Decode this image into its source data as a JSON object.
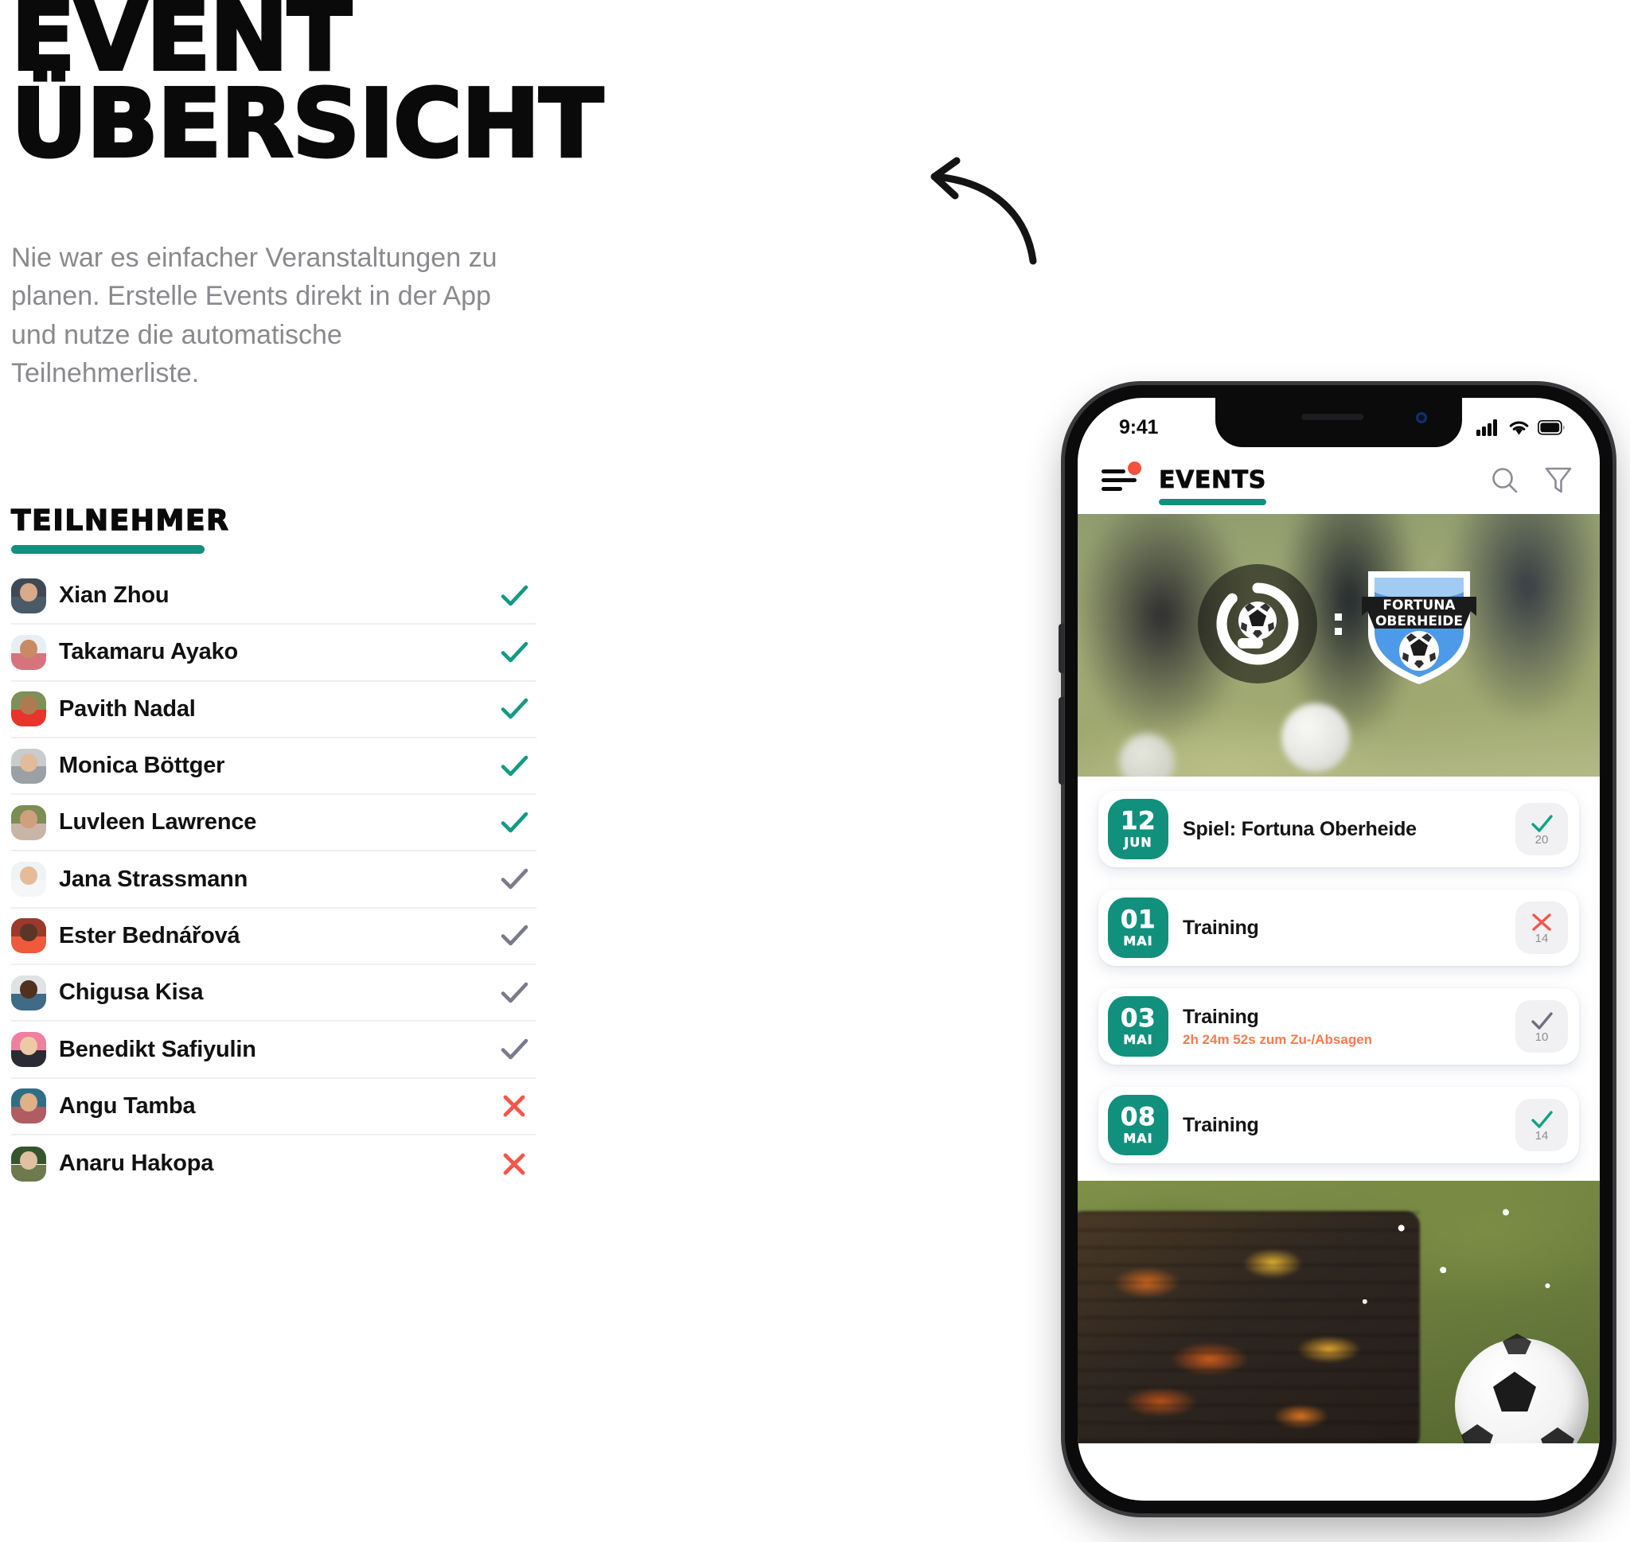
{
  "headline": {
    "line1": "EVENT",
    "line2": "ÜBERSICHT"
  },
  "lede": "Nie war es einfacher Veranstaltungen zu planen. Erstelle Events direkt in der App und nutze die automatische Teilnehmerliste.",
  "participants_section": {
    "heading": "TEILNEHMER",
    "accent_color": "#10907d",
    "people": [
      {
        "name": "Xian Zhou",
        "status": "accepted",
        "status_icon": "check-icon"
      },
      {
        "name": "Takamaru Ayako",
        "status": "accepted",
        "status_icon": "check-icon"
      },
      {
        "name": "Pavith Nadal",
        "status": "accepted",
        "status_icon": "check-icon"
      },
      {
        "name": "Monica Böttger",
        "status": "accepted",
        "status_icon": "check-icon"
      },
      {
        "name": "Luvleen Lawrence",
        "status": "accepted",
        "status_icon": "check-icon"
      },
      {
        "name": "Jana Strassmann",
        "status": "pending",
        "status_icon": "check-icon"
      },
      {
        "name": "Ester Bednářová",
        "status": "pending",
        "status_icon": "check-icon"
      },
      {
        "name": "Chigusa Kisa",
        "status": "pending",
        "status_icon": "check-icon"
      },
      {
        "name": "Benedikt Safiyulin",
        "status": "pending",
        "status_icon": "check-icon"
      },
      {
        "name": "Angu Tamba",
        "status": "declined",
        "status_icon": "close-icon"
      },
      {
        "name": "Anaru Hakopa",
        "status": "declined",
        "status_icon": "close-icon"
      }
    ],
    "status_colors": {
      "accepted": "#119a84",
      "pending": "#7b7b8c",
      "declined": "#f4564a"
    }
  },
  "phone": {
    "status_bar": {
      "time": "9:41",
      "signal_icon": "cellular-icon",
      "wifi_icon": "wifi-icon",
      "battery_icon": "battery-icon"
    },
    "app_bar": {
      "menu_icon": "hamburger-menu-icon",
      "menu_badge": true,
      "title": "EVENTS",
      "search_icon": "search-icon",
      "filter_icon": "filter-icon"
    },
    "hero": {
      "home_team_icon": "soccer-ball-logo-icon",
      "separator": ":",
      "away_team_name_line1": "FORTUNA",
      "away_team_name_line2": "OBERHEIDE",
      "away_team_icon": "fortuna-oberheide-crest-icon"
    },
    "events": [
      {
        "day": "12",
        "month": "JUN",
        "title": "Spiel: Fortuna Oberheide",
        "subtitle": "",
        "status": "accepted",
        "status_icon": "check-icon",
        "count": "20"
      },
      {
        "day": "01",
        "month": "MAI",
        "title": "Training",
        "subtitle": "",
        "status": "declined",
        "status_icon": "close-icon",
        "count": "14"
      },
      {
        "day": "03",
        "month": "MAI",
        "title": "Training",
        "subtitle": "2h 24m 52s zum Zu-/Absagen",
        "status": "pending",
        "status_icon": "check-icon",
        "count": "10"
      },
      {
        "day": "08",
        "month": "MAI",
        "title": "Training",
        "subtitle": "",
        "status": "accepted",
        "status_icon": "check-icon",
        "count": "14"
      }
    ],
    "footer_image": "bbq-grill-photo"
  }
}
